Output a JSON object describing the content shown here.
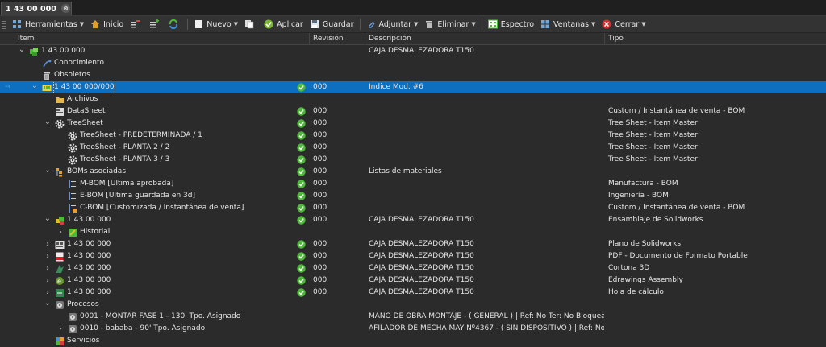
{
  "tab": {
    "title": "1 43 00 000",
    "close": "⊗"
  },
  "toolbar": {
    "herramientas": "Herramientas",
    "inicio": "Inicio",
    "nuevo": "Nuevo",
    "aplicar": "Aplicar",
    "guardar": "Guardar",
    "adjuntar": "Adjuntar",
    "eliminar": "Eliminar",
    "espectro": "Espectro",
    "ventanas": "Ventanas",
    "cerrar": "Cerrar"
  },
  "columns": {
    "item": "Item",
    "revision": "Revisión",
    "descripcion": "Descripción",
    "tipo": "Tipo"
  },
  "colors": {
    "selection": "#0e6fbf",
    "check": "#4fb83a",
    "background": "#2b2b2b"
  },
  "rows": [
    {
      "level": 1,
      "expander": "v",
      "icon": "part-green-icon",
      "item": "1 43 00 000",
      "check": false,
      "rev": "",
      "desc": "CAJA DESMALEZADORA T150",
      "tipo": ""
    },
    {
      "level": 2,
      "expander": "",
      "icon": "knowledge-icon",
      "item": "Conocimiento",
      "check": false,
      "rev": "",
      "desc": "",
      "tipo": ""
    },
    {
      "level": 2,
      "expander": "",
      "icon": "trash-icon",
      "item": "Obsoletos",
      "check": false,
      "rev": "",
      "desc": "",
      "tipo": ""
    },
    {
      "level": 2,
      "expander": "v",
      "icon": "revision-icon",
      "item": "1 43 00 000/000",
      "check": true,
      "rev": "000",
      "desc": "Indice Mod. #6",
      "tipo": "",
      "selected": true
    },
    {
      "level": 3,
      "expander": "",
      "icon": "folder-icon",
      "item": "Archivos",
      "check": false,
      "rev": "",
      "desc": "",
      "tipo": ""
    },
    {
      "level": 3,
      "expander": "",
      "icon": "datasheet-icon",
      "item": "DataSheet",
      "check": true,
      "rev": "000",
      "desc": "",
      "tipo": "Custom / Instantánea de venta - BOM"
    },
    {
      "level": 3,
      "expander": "v",
      "icon": "gear-icon",
      "item": "TreeSheet",
      "check": true,
      "rev": "000",
      "desc": "",
      "tipo": "Tree Sheet - Item Master"
    },
    {
      "level": 4,
      "expander": "",
      "icon": "gear-icon",
      "item": "TreeSheet - PREDETERMINADA / 1",
      "check": true,
      "rev": "000",
      "desc": "",
      "tipo": "Tree Sheet - Item Master"
    },
    {
      "level": 4,
      "expander": "",
      "icon": "gear-icon",
      "item": "TreeSheet - PLANTA 2 / 2",
      "check": true,
      "rev": "000",
      "desc": "",
      "tipo": "Tree Sheet - Item Master"
    },
    {
      "level": 4,
      "expander": "",
      "icon": "gear-icon",
      "item": "TreeSheet - PLANTA 3 / 3",
      "check": true,
      "rev": "000",
      "desc": "",
      "tipo": "Tree Sheet - Item Master"
    },
    {
      "level": 3,
      "expander": "v",
      "icon": "bom-icon",
      "item": "BOMs asociadas",
      "check": true,
      "rev": "000",
      "desc": "Listas de materiales",
      "tipo": ""
    },
    {
      "level": 4,
      "expander": "",
      "icon": "mbom-icon",
      "item": "M-BOM [Ultima aprobada]",
      "check": true,
      "rev": "000",
      "desc": "",
      "tipo": "Manufactura - BOM"
    },
    {
      "level": 4,
      "expander": "",
      "icon": "ebom-icon",
      "item": "E-BOM [Ultima guardada en 3d]",
      "check": true,
      "rev": "000",
      "desc": "",
      "tipo": "Ingeniería - BOM"
    },
    {
      "level": 4,
      "expander": "",
      "icon": "cbom-icon",
      "item": "C-BOM [Customizada / Instantánea de venta]",
      "check": true,
      "rev": "000",
      "desc": "",
      "tipo": "Custom / Instantánea de venta - BOM"
    },
    {
      "level": 3,
      "expander": "v",
      "icon": "assembly-icon",
      "item": "1 43 00 000",
      "check": true,
      "rev": "000",
      "desc": "CAJA DESMALEZADORA T150",
      "tipo": "Ensamblaje de Solidworks"
    },
    {
      "level": 4,
      "expander": ">",
      "icon": "history-icon",
      "item": "Historial",
      "check": false,
      "rev": "",
      "desc": "",
      "tipo": ""
    },
    {
      "level": 3,
      "expander": ">",
      "icon": "drawing-icon",
      "item": "1 43 00 000",
      "check": true,
      "rev": "000",
      "desc": "CAJA DESMALEZADORA T150",
      "tipo": "Plano de Solidworks"
    },
    {
      "level": 3,
      "expander": ">",
      "icon": "pdf-icon",
      "item": "1 43 00 000",
      "check": true,
      "rev": "000",
      "desc": "CAJA DESMALEZADORA T150",
      "tipo": "PDF - Documento de Formato Portable"
    },
    {
      "level": 3,
      "expander": ">",
      "icon": "cortona-icon",
      "item": "1 43 00 000",
      "check": true,
      "rev": "000",
      "desc": "CAJA DESMALEZADORA T150",
      "tipo": "Cortona 3D"
    },
    {
      "level": 3,
      "expander": ">",
      "icon": "edrawings-icon",
      "item": "1 43 00 000",
      "check": true,
      "rev": "000",
      "desc": "CAJA DESMALEZADORA T150",
      "tipo": "Edrawings Assembly"
    },
    {
      "level": 3,
      "expander": ">",
      "icon": "spreadsheet-icon",
      "item": "1 43 00 000",
      "check": true,
      "rev": "000",
      "desc": "CAJA DESMALEZADORA T150",
      "tipo": "Hoja de cálculo"
    },
    {
      "level": 3,
      "expander": "v",
      "icon": "process-icon",
      "item": "Procesos",
      "check": false,
      "rev": "",
      "desc": "",
      "tipo": ""
    },
    {
      "level": 4,
      "expander": "",
      "icon": "process-icon",
      "item": "0001 - MONTAR FASE 1 - 130' Tpo. Asignado",
      "check": false,
      "rev": "",
      "desc": "MANO DE OBRA MONTAJE - ( GENERAL ) | Ref: No Ter: No Bloquea...",
      "tipo": ""
    },
    {
      "level": 4,
      "expander": ">",
      "icon": "process-icon",
      "item": "0010 - bababa - 90' Tpo. Asignado",
      "check": false,
      "rev": "",
      "desc": "AFILADOR DE MECHA MAY Nº4367 - ( SIN DISPOSITIVO ) | Ref: No...",
      "tipo": ""
    },
    {
      "level": 3,
      "expander": "",
      "icon": "services-icon",
      "item": "Servicios",
      "check": false,
      "rev": "",
      "desc": "",
      "tipo": ""
    }
  ]
}
